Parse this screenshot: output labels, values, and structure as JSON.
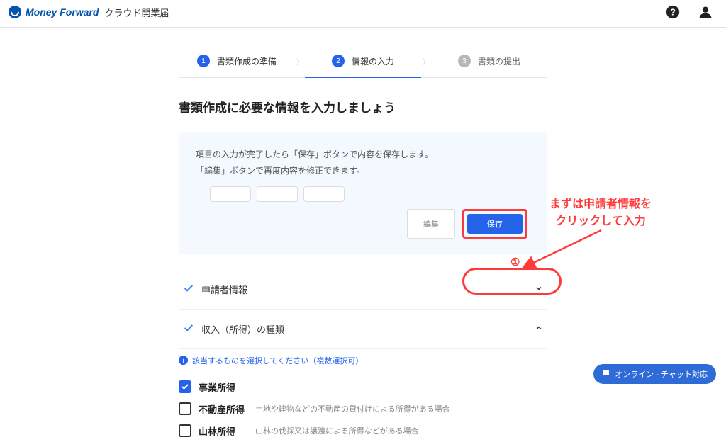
{
  "header": {
    "brand_main": "Money Forward",
    "brand_sub": "クラウド開業届"
  },
  "stepper": {
    "step1": {
      "num": "1",
      "label": "書類作成の準備"
    },
    "step2": {
      "num": "2",
      "label": "情報の入力"
    },
    "step3": {
      "num": "3",
      "label": "書類の提出"
    }
  },
  "page_title": "書類作成に必要な情報を入力しましょう",
  "info_card": {
    "line1": "項目の入力が完了したら「保存」ボタンで内容を保存します。",
    "line2": "「編集」ボタンで再度内容を修正できます。",
    "edit_label": "編集",
    "save_label": "保存"
  },
  "accordion": {
    "applicant": "申請者情報",
    "income": "収入（所得）の種類"
  },
  "income_hint": "該当するものを選択してください（複数選択可）",
  "income_options": {
    "biz": {
      "label": "事業所得",
      "desc": ""
    },
    "real": {
      "label": "不動産所得",
      "desc": "土地や建物などの不動産の貸付けによる所得がある場合"
    },
    "forest": {
      "label": "山林所得",
      "desc": "山林の伐採又は譲渡による所得などがある場合"
    }
  },
  "annotation": {
    "text_l1": "まずは申請者情報を",
    "text_l2": "クリックして入力",
    "num": "①"
  },
  "chat_label": "オンライン - チャット対応"
}
